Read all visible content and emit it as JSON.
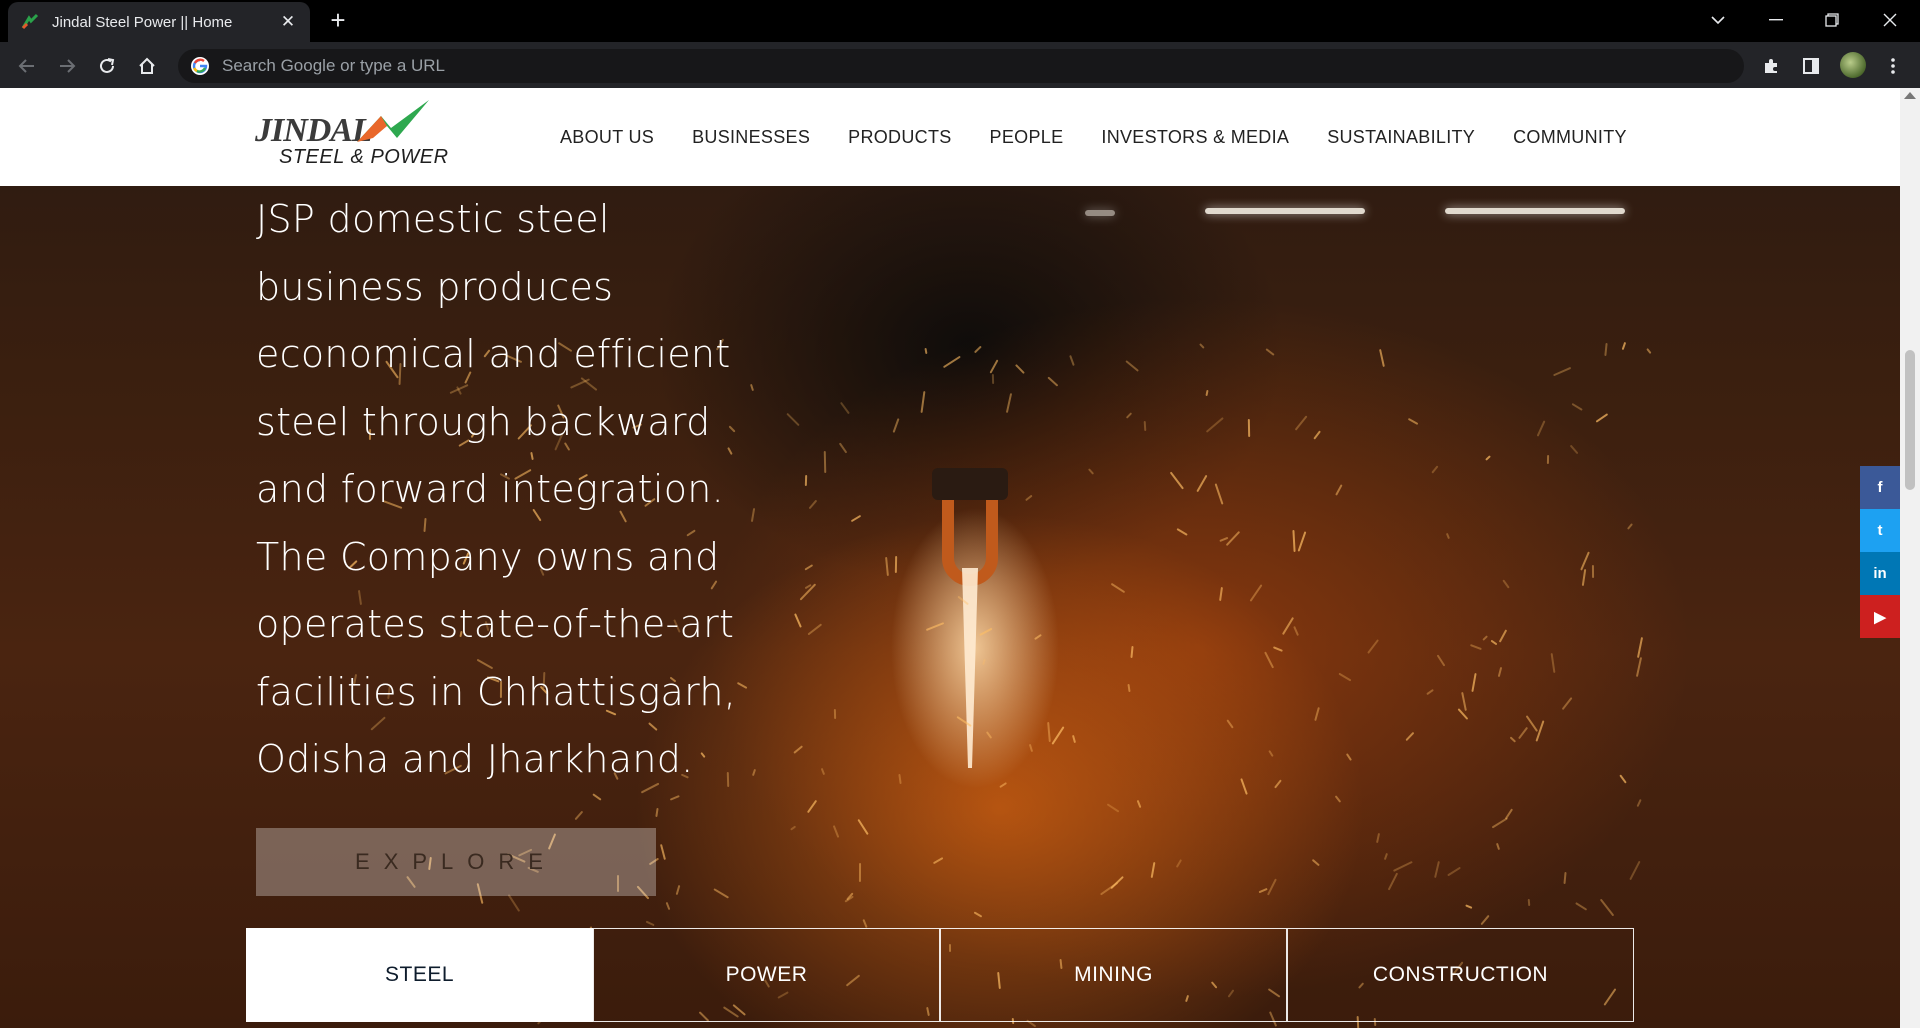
{
  "browser": {
    "tab_title": "Jindal Steel Power || Home",
    "close_glyph": "✕",
    "new_tab_glyph": "+",
    "omnibox_placeholder": "Search Google or type a URL"
  },
  "site": {
    "logo_line1": "JINDAL",
    "logo_line2": "STEEL & POWER",
    "nav": [
      "ABOUT US",
      "BUSINESSES",
      "PRODUCTS",
      "PEOPLE",
      "INVESTORS & MEDIA",
      "SUSTAINABILITY",
      "COMMUNITY"
    ],
    "hero_text": "JSP domestic steel business produces economical and efficient steel through backward and forward integration. The Company owns and operates state-of-the-art facilities in Chhattisgarh, Odisha and Jharkhand.",
    "explore_label": "EXPLORE",
    "business_tabs": [
      "STEEL",
      "POWER",
      "MINING",
      "CONSTRUCTION"
    ],
    "active_business_tab": "STEEL",
    "social": [
      {
        "name": "facebook",
        "glyph": "f",
        "color": "#3b5998"
      },
      {
        "name": "twitter",
        "glyph": "t",
        "color": "#1da1f2"
      },
      {
        "name": "linkedin",
        "glyph": "in",
        "color": "#0077b5"
      },
      {
        "name": "youtube",
        "glyph": "▶",
        "color": "#cd201f"
      }
    ]
  }
}
